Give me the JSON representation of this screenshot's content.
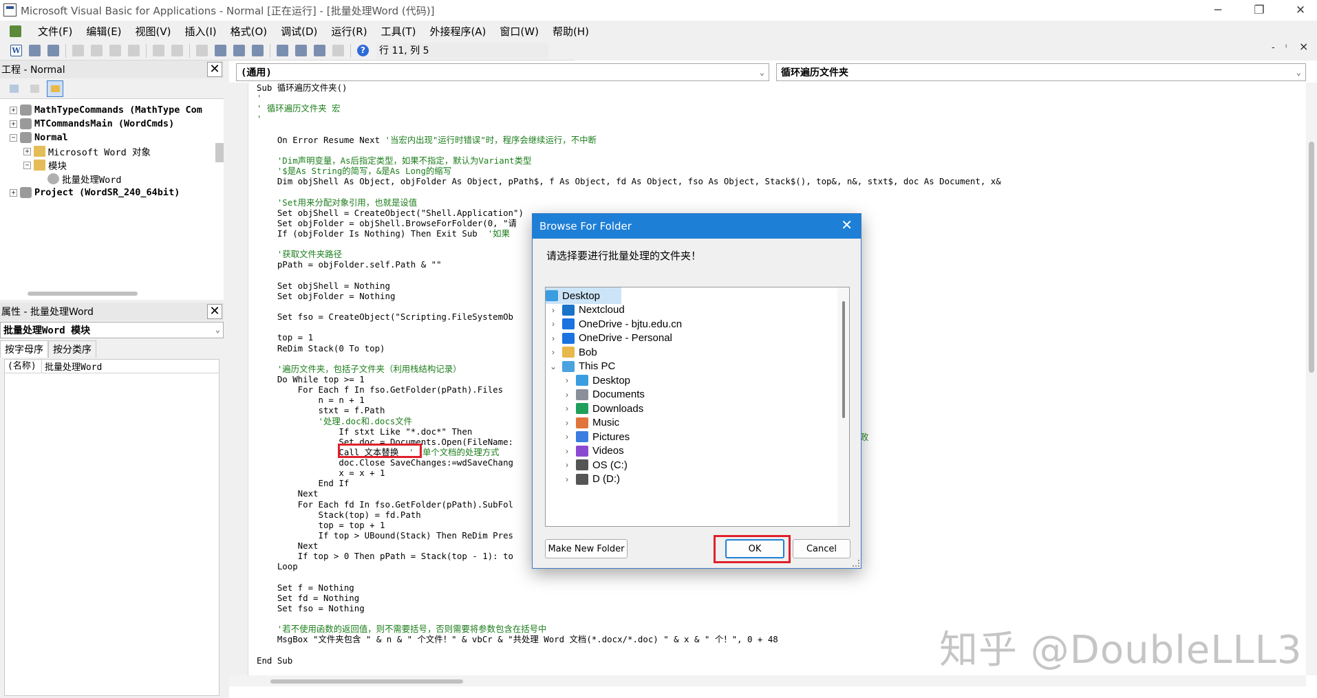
{
  "window": {
    "title": "Microsoft Visual Basic for Applications - Normal [正在运行] - [批量处理Word (代码)]",
    "controls": {
      "minimize": "─",
      "restore": "❐",
      "close": "✕"
    },
    "mdi_controls": {
      "minimize": "-",
      "restore": "ᵎ",
      "close": "×"
    }
  },
  "menubar": [
    "文件(F)",
    "编辑(E)",
    "视图(V)",
    "插入(I)",
    "格式(O)",
    "调试(D)",
    "运行(R)",
    "工具(T)",
    "外接程序(A)",
    "窗口(W)",
    "帮助(H)"
  ],
  "toolbar": {
    "position": "行 11, 列 5",
    "word_button": "W",
    "help_button": "?"
  },
  "project_pane": {
    "title": "工程 - Normal",
    "close": "✕",
    "tree": [
      {
        "label": "MathTypeCommands (MathType Com",
        "toggle": "+"
      },
      {
        "label": "MTCommandsMain (WordCmds)",
        "toggle": "+"
      },
      {
        "label": "Normal",
        "toggle": "−"
      },
      {
        "label": "Microsoft Word 对象",
        "toggle": "+"
      },
      {
        "label": "模块",
        "toggle": "−"
      },
      {
        "label": "批量处理Word",
        "toggle": ""
      },
      {
        "label": "Project (WordSR_240_64bit)",
        "toggle": "+"
      }
    ]
  },
  "properties_pane": {
    "title": "属性 - 批量处理Word",
    "close": "✕",
    "object": "批量处理Word 模块",
    "tabs": [
      "按字母序",
      "按分类序"
    ],
    "rows": [
      {
        "key": "(名称)",
        "value": "批量处理Word"
      }
    ]
  },
  "code_window": {
    "object_combo": "(通用)",
    "proc_combo": "循环遍历文件夹",
    "lines": [
      {
        "t": "Sub 循环遍历文件夹()",
        "k": ""
      },
      {
        "t": "'",
        "k": "c"
      },
      {
        "t": "' 循环遍历文件夹 宏",
        "k": "c"
      },
      {
        "t": "'",
        "k": "c"
      },
      {
        "t": "",
        "k": ""
      },
      {
        "t": "    On Error Resume Next '当宏内出现\"运行时错误\"时，程序会继续运行，不中断",
        "k": "mix",
        "split": 25
      },
      {
        "t": "",
        "k": ""
      },
      {
        "t": "    'Dim声明变量，As后指定类型，如果不指定，默认为Variant类型",
        "k": "c"
      },
      {
        "t": "    '$是As String的简写，&是As Long的缩写",
        "k": "c"
      },
      {
        "t": "    Dim objShell As Object, objFolder As Object, pPath$, f As Object, fd As Object, fso As Object, Stack$(), top&, n&, stxt$, doc As Document, x&",
        "k": ""
      },
      {
        "t": "",
        "k": ""
      },
      {
        "t": "    'Set用来分配对象引用，也就是设值",
        "k": "c"
      },
      {
        "t": "    Set objShell = CreateObject(\"Shell.Application\")",
        "k": ""
      },
      {
        "t": "    Set objFolder = objShell.BrowseForFolder(0, \"请",
        "k": ""
      },
      {
        "t": "    If (objFolder Is Nothing) Then Exit Sub  '如果",
        "k": "mix",
        "split": 45
      },
      {
        "t": "",
        "k": ""
      },
      {
        "t": "    '获取文件夹路径",
        "k": "c"
      },
      {
        "t": "    pPath = objFolder.self.Path & \"\"",
        "k": ""
      },
      {
        "t": "",
        "k": ""
      },
      {
        "t": "    Set objShell = Nothing",
        "k": ""
      },
      {
        "t": "    Set objFolder = Nothing",
        "k": ""
      },
      {
        "t": "",
        "k": ""
      },
      {
        "t": "    Set fso = CreateObject(\"Scripting.FileSystemOb",
        "k": ""
      },
      {
        "t": "",
        "k": ""
      },
      {
        "t": "    top = 1",
        "k": ""
      },
      {
        "t": "    ReDim Stack(0 To top)",
        "k": ""
      },
      {
        "t": "",
        "k": ""
      },
      {
        "t": "    '遍历文件夹，包括子文件夹（利用栈结构记录）",
        "k": "c"
      },
      {
        "t": "    Do While top >= 1",
        "k": ""
      },
      {
        "t": "        For Each f In fso.GetFolder(pPath).Files",
        "k": ""
      },
      {
        "t": "            n = n + 1",
        "k": ""
      },
      {
        "t": "            stxt = f.Path",
        "k": ""
      },
      {
        "t": "            '处理.doc和.docs文件",
        "k": "c"
      },
      {
        "t": "                If stxt Like \"*.doc*\" Then",
        "k": ""
      },
      {
        "t": "                Set doc = Documents.Open(FileName:",
        "k": ""
      },
      {
        "t": "                Call 文本替换  '【单个文档的处理方式",
        "k": "mix",
        "split": 25
      },
      {
        "t": "                doc.Close SaveChanges:=wdSaveChang",
        "k": ""
      },
      {
        "t": "                x = x + 1",
        "k": ""
      },
      {
        "t": "            End If",
        "k": ""
      },
      {
        "t": "        Next",
        "k": ""
      },
      {
        "t": "        For Each fd In fso.GetFolder(pPath).SubFol",
        "k": ""
      },
      {
        "t": "            Stack(top) = fd.Path",
        "k": ""
      },
      {
        "t": "            top = top + 1",
        "k": ""
      },
      {
        "t": "            If top > UBound(Stack) Then ReDim Pres",
        "k": ""
      },
      {
        "t": "        Next",
        "k": ""
      },
      {
        "t": "        If top > 0 Then pPath = Stack(top - 1): to",
        "k": ""
      },
      {
        "t": "    Loop",
        "k": ""
      },
      {
        "t": "",
        "k": ""
      },
      {
        "t": "    Set f = Nothing",
        "k": ""
      },
      {
        "t": "    Set fd = Nothing",
        "k": ""
      },
      {
        "t": "    Set fso = Nothing",
        "k": ""
      },
      {
        "t": "",
        "k": ""
      },
      {
        "t": "    '若不使用函数的返回值，则不需要括号，否则需要将参数包含在括号中",
        "k": "c"
      },
      {
        "t": "    MsgBox \"文件夹包含 \" & n & \" 个文件！\" & vbCr & \"共处理 Word 文档(*.docx/*.doc) \" & x & \" 个！\", 0 + 48",
        "k": ""
      },
      {
        "t": "",
        "k": ""
      },
      {
        "t": "End Sub",
        "k": ""
      }
    ],
    "overflow_fragment": "败"
  },
  "dialog": {
    "title": "Browse For Folder",
    "close": "✕",
    "prompt": "请选择要进行批量处理的文件夹！",
    "items": [
      {
        "label": "Desktop",
        "level": 0,
        "chev": "",
        "icon": "#3a9de0",
        "selected": true
      },
      {
        "label": "Nextcloud",
        "level": 1,
        "chev": "›",
        "icon": "#1a73c8"
      },
      {
        "label": "OneDrive - bjtu.edu.cn",
        "level": 1,
        "chev": "›",
        "icon": "#1a73e0"
      },
      {
        "label": "OneDrive - Personal",
        "level": 1,
        "chev": "›",
        "icon": "#1a73e0"
      },
      {
        "label": "Bob",
        "level": 1,
        "chev": "›",
        "icon": "#e8b84a"
      },
      {
        "label": "This PC",
        "level": 1,
        "chev": "⌄",
        "icon": "#4aa3df"
      },
      {
        "label": "Desktop",
        "level": 2,
        "chev": "›",
        "icon": "#3a9de0"
      },
      {
        "label": "Documents",
        "level": 2,
        "chev": "›",
        "icon": "#8a8f99"
      },
      {
        "label": "Downloads",
        "level": 2,
        "chev": "›",
        "icon": "#1fa05a"
      },
      {
        "label": "Music",
        "level": 2,
        "chev": "›",
        "icon": "#e0743a"
      },
      {
        "label": "Pictures",
        "level": 2,
        "chev": "›",
        "icon": "#3a7de0"
      },
      {
        "label": "Videos",
        "level": 2,
        "chev": "›",
        "icon": "#8a4ad0"
      },
      {
        "label": "OS (C:)",
        "level": 2,
        "chev": "›",
        "icon": "#555555"
      },
      {
        "label": "D (D:)",
        "level": 2,
        "chev": "›",
        "icon": "#555555"
      }
    ],
    "make_new_folder": "Make New Folder",
    "ok": "OK",
    "cancel": "Cancel"
  },
  "watermark": "知乎 @DoubleLLL3",
  "colors": {
    "comment": "#1b7d1b",
    "highlight": "#e0202a",
    "dialog_title": "#1e7fd6"
  }
}
